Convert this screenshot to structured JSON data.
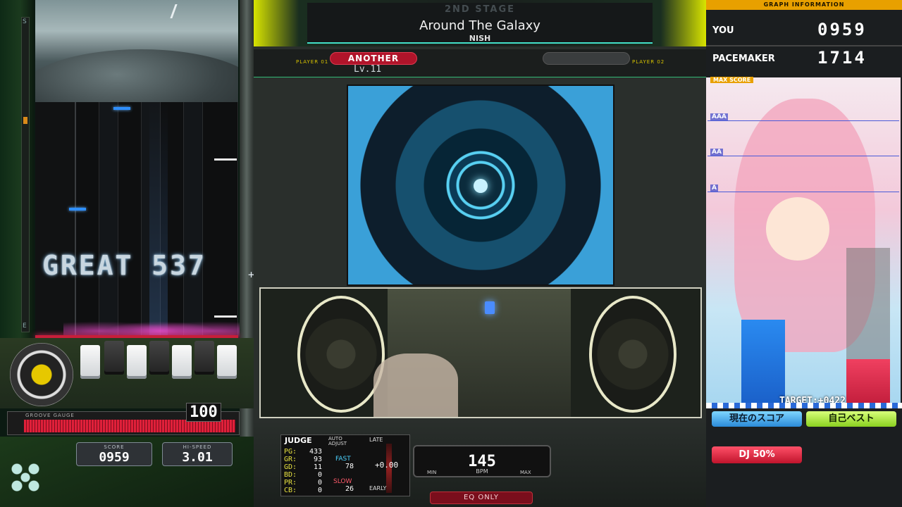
{
  "header": {
    "stage": "2ND STAGE",
    "song_title": "Around The Galaxy",
    "artist": "NISH"
  },
  "players": {
    "p1_label": "PLAYER 01",
    "p2_label": "PLAYER 02",
    "difficulty": "ANOTHER",
    "level": "Lv.11"
  },
  "playfield": {
    "judge_combo": "GREAT 537",
    "fast_slow": "+0422",
    "lane_top_label": "S",
    "lane_bottom_label": "E"
  },
  "gauge": {
    "label": "GROOVE GAUGE",
    "value": "100",
    "fill_percent": 100
  },
  "status": {
    "score_label": "SCORE",
    "score": "0959",
    "hispeed_label": "HI-SPEED",
    "hispeed": "3.01"
  },
  "judge": {
    "title": "JUDGE",
    "auto_adjust": "AUTO ADJUST",
    "late_label": "LATE",
    "early_label": "EARLY",
    "rows": [
      {
        "k": "PG:",
        "v": "433"
      },
      {
        "k": "GR:",
        "v": "93"
      },
      {
        "k": "GD:",
        "v": "11"
      },
      {
        "k": "BD:",
        "v": "0"
      },
      {
        "k": "PR:",
        "v": "0"
      },
      {
        "k": "CB:",
        "v": "0"
      }
    ],
    "fast_label": "FAST",
    "fast": "78",
    "slow_label": "SLOW",
    "slow": "26",
    "offset": "+0.00"
  },
  "bpm": {
    "value": "145",
    "label": "BPM",
    "min_label": "MIN",
    "max_label": "MAX"
  },
  "eq_only": "EQ ONLY",
  "graph": {
    "header": "GRAPH INFORMATION",
    "you_label": "YOU",
    "you_score": "0959",
    "pacemaker_label": "PACEMAKER",
    "pacemaker_score": "1714",
    "max_score_label": "MAX SCORE",
    "grades": [
      "AAA",
      "AA",
      "A"
    ],
    "you_fraction": 0.27,
    "pacemaker_fraction": 0.3,
    "target": "TARGET:+0422"
  },
  "buttons": {
    "current_score": "現在のスコア",
    "personal_best": "自己ベスト",
    "dj_level": "DJ 50%"
  }
}
